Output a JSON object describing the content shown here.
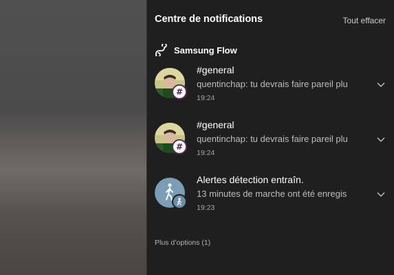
{
  "panel": {
    "title": "Centre de notifications",
    "clear_all_label": "Tout effacer",
    "more_options_label": "Plus d’options (1)"
  },
  "app_group": {
    "name": "Samsung Flow",
    "icon": "samsung-flow-icon"
  },
  "notifications": [
    {
      "title": "#general",
      "body": "quentinchap: tu devrais faire pareil plu",
      "time": "19:24",
      "avatar": "user-photo",
      "badge_icon": "slack-hash-icon",
      "badge_glyph": "#"
    },
    {
      "title": "#general",
      "body": "quentinchap: tu devrais faire pareil plu",
      "time": "19:24",
      "avatar": "user-photo",
      "badge_icon": "slack-hash-icon",
      "badge_glyph": "#"
    },
    {
      "title": "Alertes détection entraîn.",
      "body": "13 minutes de marche ont été enregis",
      "time": "19:23",
      "avatar": "walking-person-icon",
      "badge_icon": "health-badge-icon"
    }
  ],
  "colors": {
    "panel_background": "#1f1f1f",
    "slack_badge_border": "#5a2f55",
    "health_avatar": "#7b9db5"
  }
}
